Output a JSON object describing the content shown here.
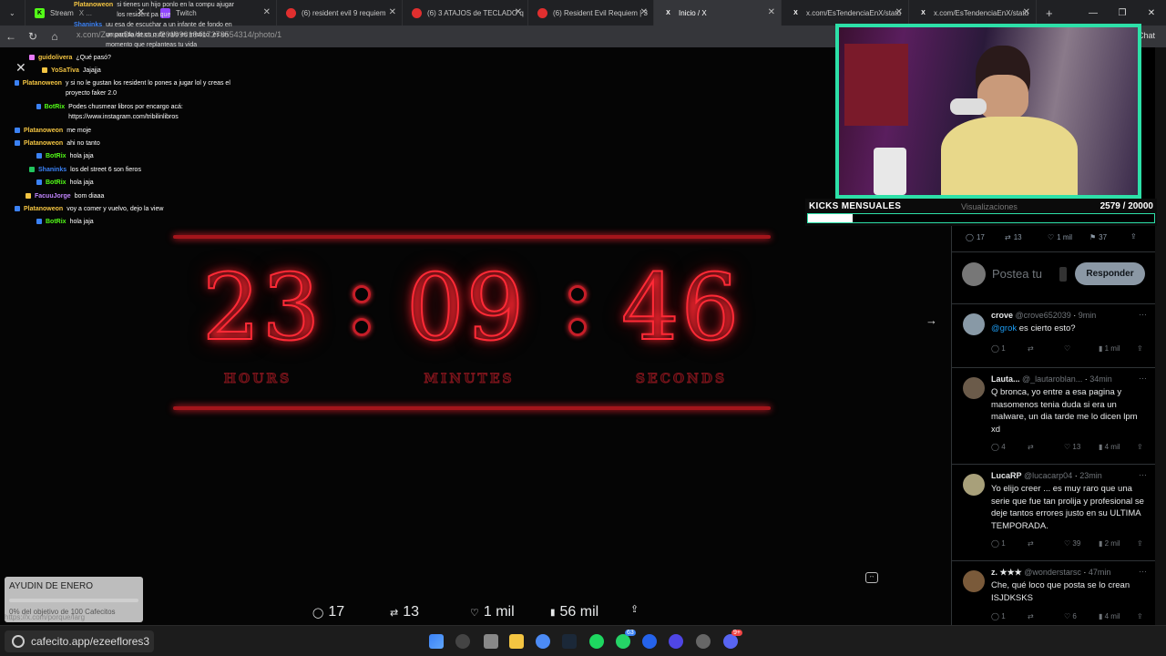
{
  "browser": {
    "tabs": [
      {
        "title": "Stream",
        "subtitle": "X ...",
        "favicon": "K",
        "favicon_color": "#53fc18",
        "active": false
      },
      {
        "title": "Twitch",
        "favicon": "",
        "favicon_color": "#9146ff",
        "active": false
      },
      {
        "title": "(6) resident evil 9 requiem",
        "favicon": "",
        "favicon_color": "#e02f2f",
        "active": false
      },
      {
        "title": "(6) 3 ATAJOS de TECLADO q",
        "favicon": "",
        "favicon_color": "#e02f2f",
        "active": false
      },
      {
        "title": "(6) Resident Evil Requiem | 3",
        "favicon": "",
        "favicon_color": "#e02f2f",
        "active": false
      },
      {
        "title": "Inicio / X",
        "favicon": "X",
        "favicon_color": "#000000",
        "active": true
      },
      {
        "title": "x.com/EsTendenciaEnX/statu",
        "favicon": "X",
        "favicon_color": "#000000",
        "active": false
      },
      {
        "title": "x.com/EsTendenciaEnX/statu",
        "favicon": "X",
        "favicon_color": "#000000",
        "active": false
      }
    ],
    "url": "x.com/ZeneaDe/status/2019901841727855431​4/photo/1",
    "chat_button": "Chat"
  },
  "chat": [
    {
      "user": "Platanoweon",
      "color": "#f4c542",
      "text": "si tienes un hijo ponlo en la compu ajugar los resident pa que"
    },
    {
      "user": "Shaninks",
      "color": "#3b82f6",
      "text": "uu esa de escuchar a un infante de fondo en un partida de cs o de valo es místico, es un momento que replanteas tu vida"
    },
    {
      "user": "guidolivera",
      "color": "#f4c542",
      "text": "¿Qué pasó?"
    },
    {
      "user": "YoSaTiva",
      "color": "#f4c542",
      "text": "Jajajja"
    },
    {
      "user": "Platanoweon",
      "color": "#f4c542",
      "text": "y si no le gustan los resident lo pones a jugar lol y creas el proyecto faker 2.0"
    },
    {
      "user": "BotRix",
      "color": "#53fc18",
      "text": "Podes chusmear libros por encargo acá: https://www.instagram.com/tribilinlibros"
    },
    {
      "user": "Platanoweon",
      "color": "#f4c542",
      "text": "me moje"
    },
    {
      "user": "Platanoweon",
      "color": "#f4c542",
      "text": "ahi no tanto"
    },
    {
      "user": "BotRix",
      "color": "#53fc18",
      "text": "hola jaja"
    },
    {
      "user": "Shaninks",
      "color": "#3b82f6",
      "text": "los del street 6 son fieros"
    },
    {
      "user": "BotRix",
      "color": "#53fc18",
      "text": "hola jaja"
    },
    {
      "user": "FacuuJorge",
      "color": "#c084fc",
      "text": "bom diaaa"
    },
    {
      "user": "Platanoweon",
      "color": "#f4c542",
      "text": "voy a comer y vuelvo, dejo la view"
    },
    {
      "user": "BotRix",
      "color": "#53fc18",
      "text": "hola jaja"
    }
  ],
  "countdown": {
    "hours": "23",
    "minutes": "09",
    "seconds": "46",
    "hours_label": "HOURS",
    "minutes_label": "MINUTES",
    "seconds_label": "SECONDS",
    "neon_color": "#ff2a36"
  },
  "photo_actions": {
    "replies": "17",
    "reposts": "13",
    "likes": "1 mil",
    "views": "56 mil"
  },
  "cafecito": {
    "title": "AYUDIN DE ENERO",
    "subtitle": "0% del objetivo de 100 Cafecitos",
    "progress": 0.0,
    "status_url": "https://x.com/porque/larg"
  },
  "kicks": {
    "label": "KICKS MENSUALES",
    "views_label": "Visualizaciones",
    "current": "2579",
    "goal": "20000",
    "progress": 0.129,
    "accent": "#2de0a8"
  },
  "post_stats": {
    "replies": "17",
    "reposts": "13",
    "likes": "1 mil",
    "bookmarks": "37"
  },
  "reply_box": {
    "placeholder": "Postea tu",
    "button": "Responder"
  },
  "replies": [
    {
      "name": "crove",
      "handle": "@crove652039",
      "time": "9min",
      "mention": "@grok",
      "text": "es cierto esto?",
      "replies": "1",
      "reposts": "",
      "likes": "",
      "views": "1 mil"
    },
    {
      "name": "Lauta...",
      "handle": "@_lautaroblan...",
      "time": "34min",
      "text": "Q bronca, yo entre a esa pagina y masomenos tenia duda si era un malware, un dia tarde me lo dicen lpm xd",
      "replies": "4",
      "reposts": "",
      "likes": "13",
      "views": "4 mil"
    },
    {
      "name": "LucaRP",
      "handle": "@lucacarp04",
      "time": "23min",
      "text": "Yo elijo creer ... es muy raro que una serie que fue tan prolija y profesional se deje tantos errores justo en su ULTIMA TEMPORADA.",
      "replies": "1",
      "reposts": "",
      "likes": "39",
      "views": "2 mil"
    },
    {
      "name": "z. ★★★",
      "handle": "@wonderstarsc",
      "time": "47min",
      "text": "Che, qué loco que posta se lo crean ISJDKSKS",
      "replies": "1",
      "reposts": "",
      "likes": "6",
      "views": "4 mil"
    }
  ],
  "taskbar": {
    "search_label": "cafecito.app/ezeeflores3",
    "badge_1": "63",
    "badge_2": "9+"
  }
}
